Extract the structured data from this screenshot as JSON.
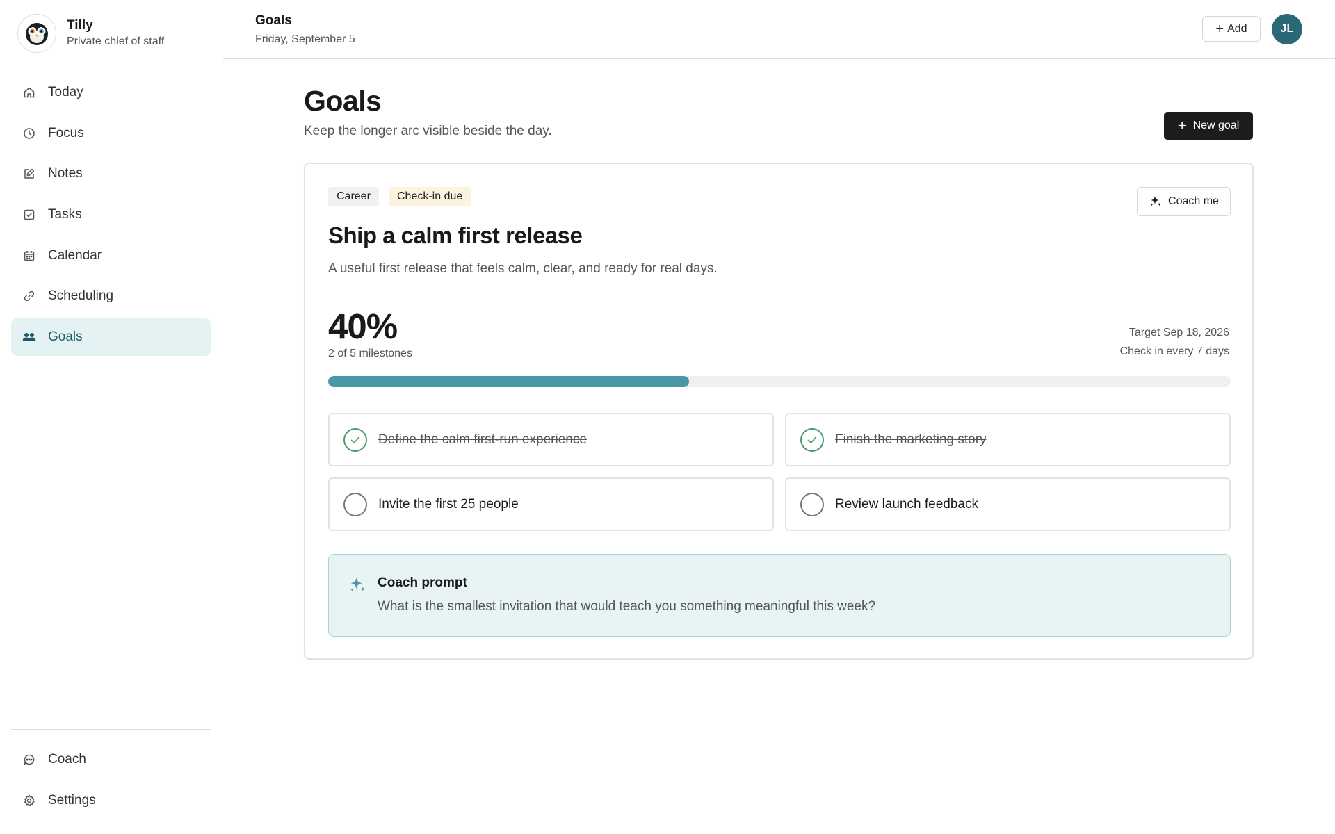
{
  "brand": {
    "name": "Tilly",
    "tagline": "Private chief of staff"
  },
  "sidebar": {
    "items": [
      {
        "label": "Today",
        "icon": "home-icon"
      },
      {
        "label": "Focus",
        "icon": "clock-icon"
      },
      {
        "label": "Notes",
        "icon": "edit-icon"
      },
      {
        "label": "Tasks",
        "icon": "checkbox-icon"
      },
      {
        "label": "Calendar",
        "icon": "calendar-icon"
      },
      {
        "label": "Scheduling",
        "icon": "link-icon"
      },
      {
        "label": "Goals",
        "icon": "people-icon",
        "active": true
      }
    ],
    "bottom_items": [
      {
        "label": "Coach",
        "icon": "chat-icon"
      },
      {
        "label": "Settings",
        "icon": "gear-icon"
      }
    ]
  },
  "header": {
    "title": "Goals",
    "date": "Friday, September 5",
    "add_label": "Add",
    "avatar_initials": "JL"
  },
  "page": {
    "title": "Goals",
    "subtitle": "Keep the longer arc visible beside the day.",
    "new_goal_label": "New goal"
  },
  "goal": {
    "tags": [
      "Career",
      "Check-in due"
    ],
    "coach_button_label": "Coach me",
    "title": "Ship a calm first release",
    "description": "A useful first release that feels calm, clear, and ready for real days.",
    "progress_percent": "40%",
    "progress_fraction": 0.4,
    "milestone_count": "2 of 5 milestones",
    "target": "Target Sep 18, 2026",
    "checkin_frequency": "Check in every 7 days",
    "milestones": [
      {
        "label": "Define the calm first-run experience",
        "done": true
      },
      {
        "label": "Finish the marketing story",
        "done": true
      },
      {
        "label": "Invite the first 25 people",
        "done": false
      },
      {
        "label": "Review launch feedback",
        "done": false
      }
    ],
    "coach_prompt": {
      "title": "Coach prompt",
      "text": "What is the smallest invitation that would teach you something meaningful this week?"
    }
  },
  "colors": {
    "accent": "#4797a4",
    "active_nav_bg": "#e4f2f3",
    "avatar_bg": "#2a6877",
    "coach_prompt_bg": "#e8f4f4",
    "done_check": "#4a9a6a",
    "checkin_tag_bg": "#fcf2de"
  }
}
